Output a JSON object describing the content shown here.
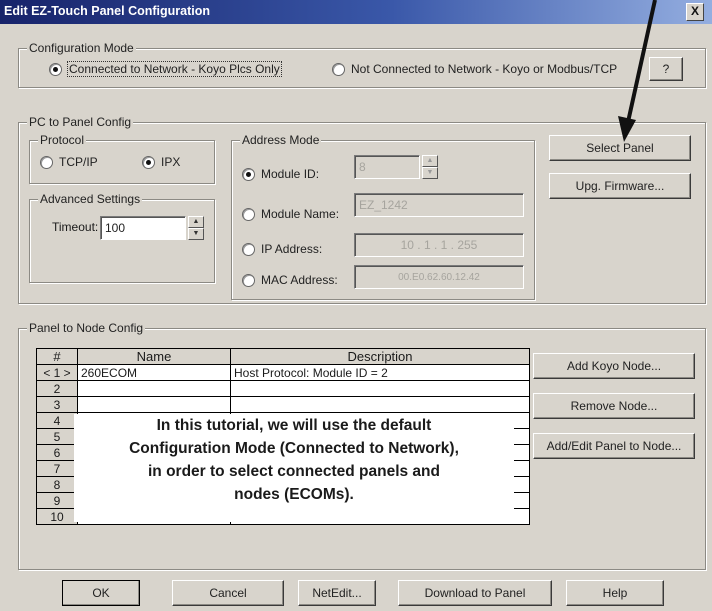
{
  "window": {
    "title": "Edit EZ-Touch Panel Configuration",
    "close_label": "X"
  },
  "config_mode": {
    "legend": "Configuration Mode",
    "option_connected": "Connected to Network - Koyo Plcs Only",
    "option_not_connected": "Not Connected to Network - Koyo or Modbus/TCP",
    "help_label": "?"
  },
  "pc_to_panel": {
    "legend": "PC to Panel Config",
    "protocol": {
      "legend": "Protocol",
      "tcpip": "TCP/IP",
      "ipx": "IPX"
    },
    "advanced": {
      "legend": "Advanced Settings",
      "timeout_label": "Timeout:",
      "timeout_value": "100"
    },
    "address_mode": {
      "legend": "Address Mode",
      "module_id_label": "Module ID:",
      "module_id_value": "8",
      "module_name_label": "Module Name:",
      "module_name_value": "EZ_1242",
      "ip_label": "IP Address:",
      "ip_value": "10 . 1 . 1 . 255",
      "mac_label": "MAC Address:",
      "mac_value": "00.E0.62.60.12.42"
    },
    "select_panel": "Select Panel",
    "upg_firmware": "Upg. Firmware..."
  },
  "panel_to_node": {
    "legend": "Panel to Node Config",
    "columns": [
      "#",
      "Name",
      "Description"
    ],
    "rows": [
      {
        "num": "< 1 >",
        "name": "260ECOM",
        "desc": "Host Protocol: Module ID = 2"
      },
      {
        "num": "2",
        "name": "",
        "desc": ""
      },
      {
        "num": "3",
        "name": "",
        "desc": ""
      },
      {
        "num": "4",
        "name": "",
        "desc": ""
      },
      {
        "num": "5",
        "name": "",
        "desc": ""
      },
      {
        "num": "6",
        "name": "",
        "desc": ""
      },
      {
        "num": "7",
        "name": "",
        "desc": ""
      },
      {
        "num": "8",
        "name": "",
        "desc": ""
      },
      {
        "num": "9",
        "name": "",
        "desc": ""
      },
      {
        "num": "10",
        "name": "",
        "desc": ""
      }
    ],
    "add_koyo_node": "Add Koyo Node...",
    "remove_node": "Remove Node...",
    "add_edit_panel_node": "Add/Edit Panel to Node..."
  },
  "annotation": {
    "line1": "In this tutorial, we will use the default",
    "line2": "Configuration Mode (Connected to Network),",
    "line3": "in order to select connected panels and",
    "line4": "nodes (ECOMs).",
    "arrow_color": "#111111"
  },
  "footer": {
    "ok": "OK",
    "cancel": "Cancel",
    "netedit": "NetEdit...",
    "download": "Download to Panel",
    "help": "Help"
  }
}
